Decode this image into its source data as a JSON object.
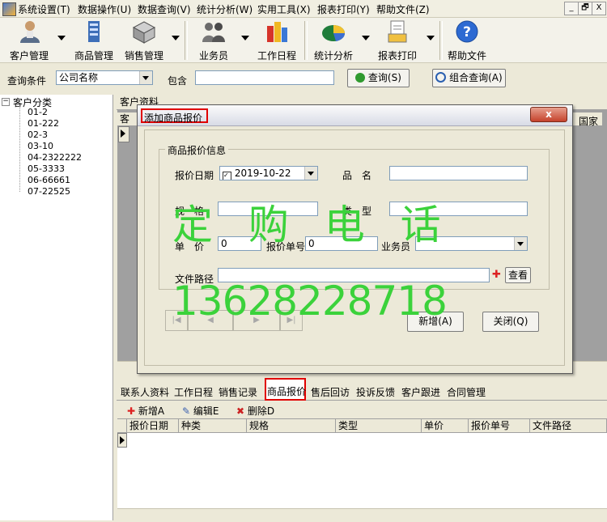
{
  "menubar": {
    "items": [
      "系统设置(T)",
      "数据操作(U)",
      "数据查询(V)",
      "统计分析(W)",
      "实用工具(X)",
      "报表打印(Y)",
      "帮助文件(Z)"
    ],
    "window_buttons": [
      "_",
      "🗗",
      "X"
    ]
  },
  "toolbar": {
    "buttons": [
      "客户管理",
      "商品管理",
      "销售管理",
      "业务员",
      "工作日程",
      "统计分析",
      "报表打印",
      "帮助文件"
    ]
  },
  "query": {
    "label": "查询条件",
    "field_value": "公司名称",
    "contains_label": "包含",
    "input_value": "",
    "search_button": "查询(S)",
    "combined_button": "组合查询(A)"
  },
  "tree": {
    "root": "客户分类",
    "nodes": [
      "01-2",
      "01-222",
      "02-3",
      "03-10",
      "04-2322222",
      "05-3333",
      "06-66661",
      "07-22525"
    ]
  },
  "customer_panel": {
    "tab": "客户资料",
    "header_left": "客",
    "header_right": "国家"
  },
  "dialog": {
    "title": "添加商品报价",
    "close": "x",
    "group_title": "商品报价信息",
    "date_label": "报价日期",
    "date_value": "2019-10-22",
    "name_label": "品　名",
    "spec_label": "规　格",
    "type_label": "类　型",
    "price_label": "单　价",
    "price_value": "0",
    "quote_no_label": "报价单号",
    "quote_no_value": "0",
    "salesman_label": "业务员",
    "file_label": "文件路径",
    "view_button": "查看",
    "add_button": "新增(A)",
    "close_button": "关闭(Q)",
    "nav": [
      "|◀",
      "◀",
      "▶",
      "▶|"
    ]
  },
  "watermark": {
    "line1": "定 购 电 话",
    "line2": "13628228718"
  },
  "bottom_tabs": [
    "联系人资料",
    "工作日程",
    "销售记录",
    "商品报价",
    "售后回访",
    "投诉反馈",
    "客户跟进",
    "合同管理"
  ],
  "bottom_toolbar": {
    "add": "新增A",
    "edit": "编辑E",
    "delete": "删除D"
  },
  "bottom_grid": {
    "columns": [
      "报价日期",
      "种类",
      "规格",
      "类型",
      "单价",
      "报价单号",
      "文件路径"
    ]
  },
  "colors": {
    "highlight": "#e00000",
    "watermark": "#3bd23b",
    "window_bg": "#ece9d8"
  }
}
